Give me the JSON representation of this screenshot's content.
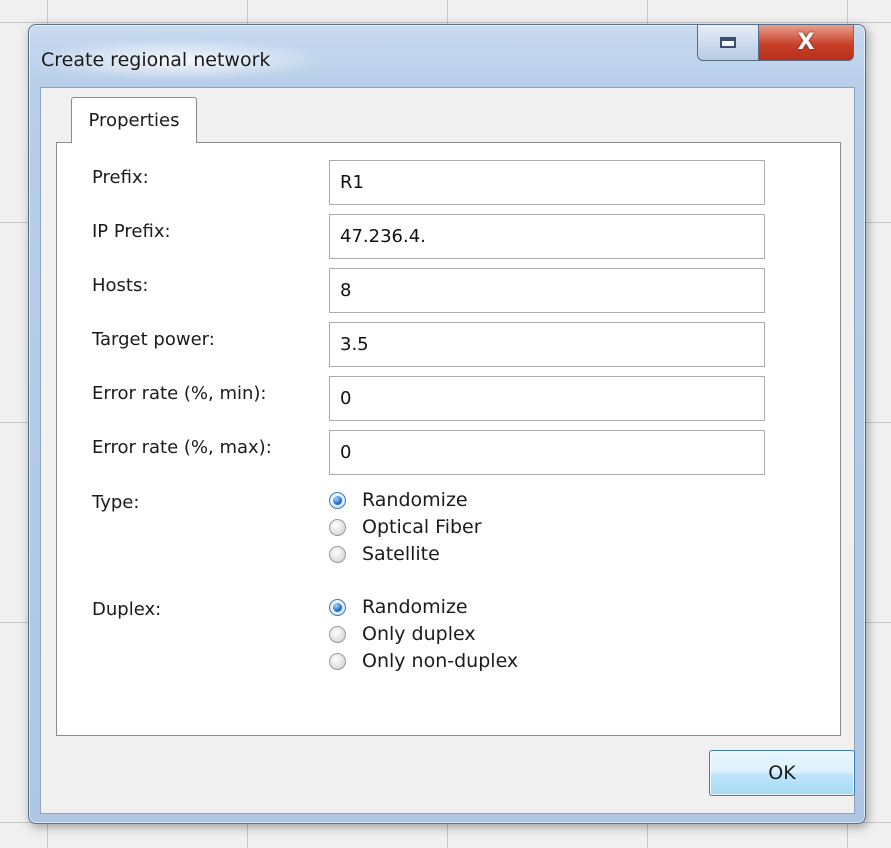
{
  "window": {
    "title": "Create regional network",
    "restore_icon": "restore-icon",
    "close_icon": "close-icon",
    "close_glyph": "X"
  },
  "tabs": [
    {
      "label": "Properties",
      "selected": true
    }
  ],
  "form": {
    "fields": [
      {
        "label": "Prefix:",
        "value": "R1"
      },
      {
        "label": "IP Prefix:",
        "value": "47.236.4."
      },
      {
        "label": "Hosts:",
        "value": "8"
      },
      {
        "label": "Target power:",
        "value": "3.5"
      },
      {
        "label": "Error rate (%, min):",
        "value": "0"
      },
      {
        "label": "Error rate (%, max):",
        "value": "0"
      }
    ],
    "type": {
      "label": "Type:",
      "options": [
        "Randomize",
        "Optical Fiber",
        "Satellite"
      ],
      "selected": "Randomize"
    },
    "duplex": {
      "label": "Duplex:",
      "options": [
        "Randomize",
        "Only duplex",
        "Only non-duplex"
      ],
      "selected": "Randomize"
    }
  },
  "footer": {
    "ok_label": "OK"
  },
  "colors": {
    "title_bar": "#b9cfe9",
    "close_button": "#c8412b",
    "ok_button": "#bee6fd",
    "radio_selected": "#1f6fd1"
  }
}
